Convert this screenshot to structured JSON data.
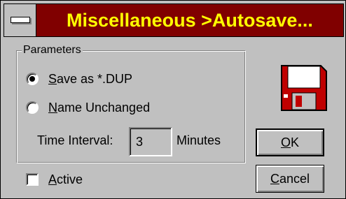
{
  "window": {
    "title": "Miscellaneous >Autosave...",
    "system_menu_icon": "system-menu-bar-icon",
    "colors": {
      "face": "#c0c0c0",
      "titlebar": "#800000",
      "title_text": "#ffff00",
      "disk": "#c00000"
    }
  },
  "parameters": {
    "group_label": "Parameters",
    "options": [
      {
        "before": "",
        "mnemonic": "S",
        "after": "ave as  *.DUP",
        "selected": true
      },
      {
        "before": "",
        "mnemonic": "N",
        "after": "ame Unchanged",
        "selected": false
      }
    ],
    "time_interval": {
      "label": "Time Interval:",
      "value": "3",
      "units": "Minutes"
    }
  },
  "active": {
    "before": "",
    "mnemonic": "A",
    "after": "ctive",
    "checked": false
  },
  "icon": {
    "name": "floppy-disk-icon"
  },
  "buttons": {
    "ok": {
      "before": "",
      "mnemonic": "O",
      "after": "K"
    },
    "cancel": {
      "before": "",
      "mnemonic": "C",
      "after": "ancel"
    }
  }
}
